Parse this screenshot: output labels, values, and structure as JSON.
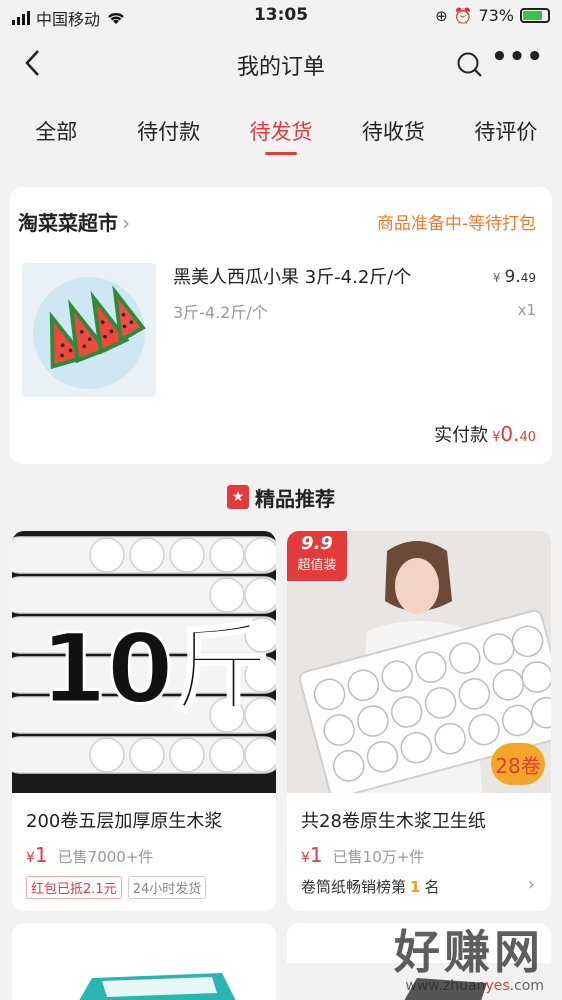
{
  "status_bar": {
    "carrier": "中国移动",
    "time": "13:05",
    "battery": "73%"
  },
  "nav": {
    "title": "我的订单"
  },
  "tabs": [
    {
      "label": "全部"
    },
    {
      "label": "待付款"
    },
    {
      "label": "待发货"
    },
    {
      "label": "待收货"
    },
    {
      "label": "待评价"
    }
  ],
  "order": {
    "shop_name": "淘菜菜超市",
    "status": "商品准备中-等待打包",
    "item_name": "黑美人西瓜小果 3斤-4.2斤/个",
    "item_spec": "3斤-4.2斤/个",
    "price_currency": "¥",
    "price_int": "9.",
    "price_dec": "49",
    "quantity": "x1",
    "paid_label": "实付款",
    "paid_currency": "¥",
    "paid_int": "0.",
    "paid_dec": "40"
  },
  "recommend": {
    "title": "精品推荐"
  },
  "products": [
    {
      "image_text": "10斤",
      "name": "200卷五层加厚原生木浆",
      "price_currency": "¥",
      "price": "1",
      "sold": "已售7000+件",
      "tags": [
        "红包已抵2.1元",
        "24小时发货"
      ]
    },
    {
      "badge_top": "9.9",
      "badge_bottom": "超值装",
      "badge_rolls": "28卷",
      "name": "共28卷原生木浆卫生纸",
      "price_currency": "¥",
      "price": "1",
      "sold": "已售10万+件",
      "rank_prefix": "卷筒纸畅销榜第",
      "rank_num": "1",
      "rank_suffix": "名"
    }
  ],
  "watermark": {
    "big": "好赚网",
    "small_pre": "www.zhuan",
    "small_accent": "yes",
    "small_post": ".com"
  },
  "colors": {
    "accent_red": "#e33b3b",
    "status_orange": "#f07a2a",
    "background": "#f2f2f2"
  }
}
